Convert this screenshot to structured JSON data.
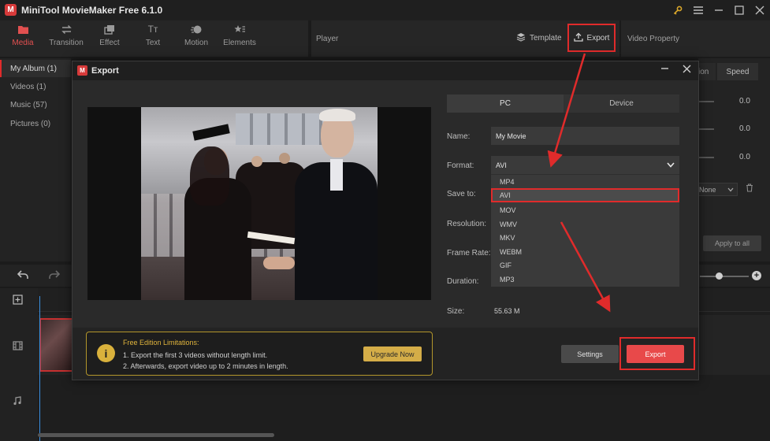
{
  "app": {
    "title": "MiniTool MovieMaker Free 6.1.0",
    "logo_glyph": "M"
  },
  "window_controls": [
    "key-icon",
    "menu-icon",
    "minimize-icon",
    "maximize-icon",
    "close-icon"
  ],
  "toolbar": {
    "items": [
      {
        "label": "Media",
        "icon": "folder-icon",
        "active": true
      },
      {
        "label": "Transition",
        "icon": "transition-icon",
        "active": false
      },
      {
        "label": "Effect",
        "icon": "effect-icon",
        "active": false
      },
      {
        "label": "Text",
        "icon": "text-icon",
        "active": false
      },
      {
        "label": "Motion",
        "icon": "motion-icon",
        "active": false
      },
      {
        "label": "Elements",
        "icon": "elements-icon",
        "active": false
      }
    ],
    "text_glyph": "Tт"
  },
  "player": {
    "label": "Player",
    "template_label": "Template",
    "export_label": "Export"
  },
  "video_property": {
    "label": "Video Property"
  },
  "media_panel": {
    "items": [
      {
        "label": "My Album (1)",
        "active": true
      },
      {
        "label": "Videos (1)",
        "active": false
      },
      {
        "label": "Music (57)",
        "active": false
      },
      {
        "label": "Pictures (0)",
        "active": false
      }
    ]
  },
  "property_panel": {
    "tab_partial": "ion",
    "tab_speed": "Speed",
    "values": [
      "0.0",
      "0.0",
      "0.0"
    ],
    "dropdown_value": "None",
    "apply_all": "Apply to all"
  },
  "dialog": {
    "title": "Export",
    "logo_glyph": "M",
    "tabs": {
      "pc": "PC",
      "device": "Device"
    },
    "labels": {
      "name": "Name:",
      "format": "Format:",
      "save_to": "Save to:",
      "resolution": "Resolution:",
      "frame_rate": "Frame Rate:",
      "duration": "Duration:",
      "size": "Size:"
    },
    "name_value": "My Movie",
    "format_value": "AVI",
    "size_value": "55.63 M",
    "format_options": [
      "MP4",
      "AVI",
      "MOV",
      "WMV",
      "MKV",
      "WEBM",
      "GIF",
      "MP3"
    ],
    "selected_format_index": 1,
    "limits": {
      "title": "Free Edition Limitations:",
      "line1": "1. Export the first 3 videos without length limit.",
      "line2": "2. Afterwards, export video up to 2 minutes in length."
    },
    "upgrade_label": "Upgrade Now",
    "settings_label": "Settings",
    "export_label": "Export"
  },
  "colors": {
    "accent_red": "#e02b2b",
    "export_button": "#e8494a",
    "warning_gold": "#d9b13c"
  }
}
